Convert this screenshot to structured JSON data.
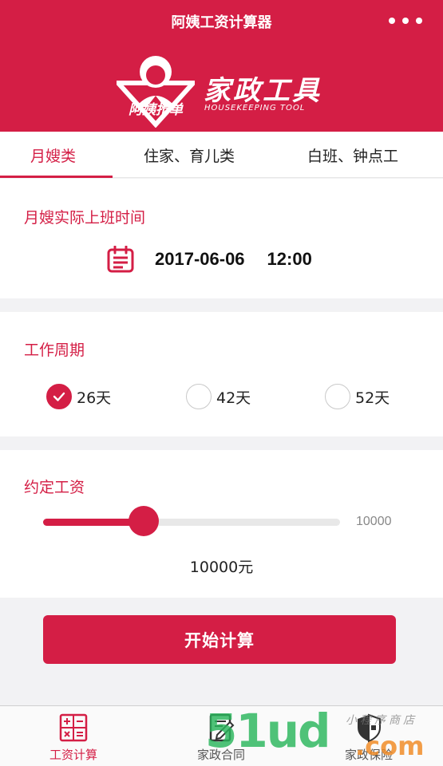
{
  "nav": {
    "title": "阿姨工资计算器"
  },
  "banner": {
    "badge_text": "阿姨抢单",
    "title": "家政工具",
    "subtitle": "HOUSEKEEPING TOOL"
  },
  "tabs": [
    {
      "label": "月嫂类",
      "active": true
    },
    {
      "label": "住家、育儿类",
      "active": false
    },
    {
      "label": "白班、钟点工",
      "active": false
    }
  ],
  "work_time": {
    "title": "月嫂实际上班时间",
    "date": "2017-06-06",
    "time": "12:00"
  },
  "work_period": {
    "title": "工作周期",
    "options": [
      {
        "label": "26天",
        "checked": true
      },
      {
        "label": "42天",
        "checked": false
      },
      {
        "label": "52天",
        "checked": false
      }
    ]
  },
  "salary": {
    "title": "约定工资",
    "slider_max_label": "10000",
    "slider_level": 0.34,
    "value_text": "10000元"
  },
  "start_button": {
    "label": "开始计算"
  },
  "tabbar": {
    "items": [
      {
        "label": "工资计算",
        "active": true
      },
      {
        "label": "家政合同",
        "active": false
      },
      {
        "label": "家政保险",
        "active": false
      }
    ]
  },
  "watermark": {
    "main": "51ud",
    "suffix": ".com",
    "small": "小程序商店"
  },
  "colors": {
    "brand": "#d41e45",
    "background": "#f2f2f4"
  }
}
